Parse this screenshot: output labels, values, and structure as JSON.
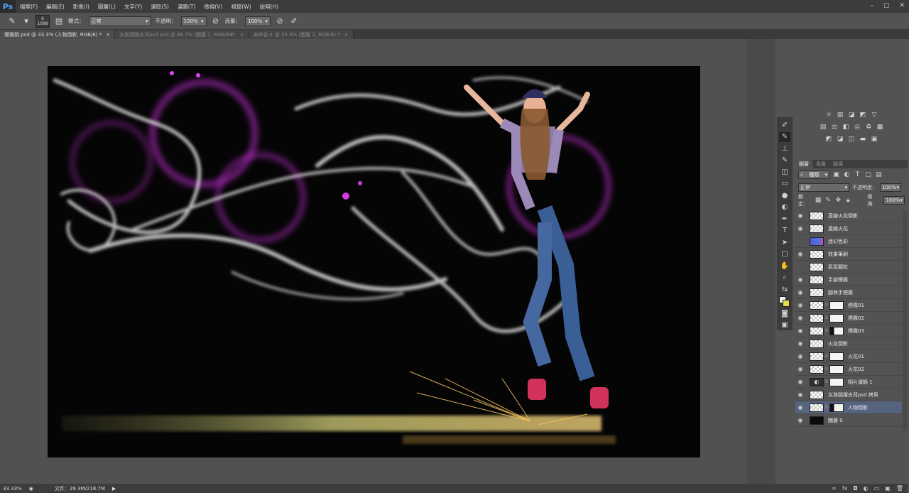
{
  "app": {
    "logo": "Ps"
  },
  "menu": [
    "檔案(F)",
    "編輯(E)",
    "影像(I)",
    "圖層(L)",
    "文字(Y)",
    "選取(S)",
    "濾鏡(T)",
    "檢視(V)",
    "視窗(W)",
    "說明(H)"
  ],
  "window_controls": [
    "–",
    "▢",
    "✕"
  ],
  "options": {
    "brush_size": "6",
    "brush_size2": "1098",
    "mode_label": "模式：",
    "mode_value": "正常",
    "opacity_label": "不透明：",
    "opacity_value": "100%",
    "flow_label": "流量：",
    "flow_value": "100%"
  },
  "tabs": [
    {
      "label": "煙霧跳.psd @ 33.3% (人物倒影, RGB/8) *"
    },
    {
      "label": "女孩跳躍去背psd.psd @ 66.7% (圖層 1, RGB/8#)"
    },
    {
      "label": "未命名-1 @ 33.3% (圖層 2, RGB/8) *"
    }
  ],
  "tab_close": "×",
  "layers_panel": {
    "tabs": [
      "圖層",
      "色版",
      "路徑"
    ],
    "filter_label": "種類",
    "blend_mode": "正常",
    "opacity_label": "不透明度：",
    "opacity_value": "100%",
    "lock_label": "鎖定：",
    "fill_label": "填滿：",
    "fill_value": "100%",
    "layers": [
      {
        "name": "直線火花倒影",
        "visible": true
      },
      {
        "name": "直線火花",
        "visible": true
      },
      {
        "name": "迷幻色彩",
        "visible": false
      },
      {
        "name": "效果筆刷",
        "visible": true
      },
      {
        "name": "氣氛顆粒",
        "visible": false
      },
      {
        "name": "手部煙霧",
        "visible": true
      },
      {
        "name": "腳與手煙霧",
        "visible": true
      },
      {
        "name": "煙霧01",
        "visible": true
      },
      {
        "name": "煙霧02",
        "visible": true
      },
      {
        "name": "煙霧03",
        "visible": true
      },
      {
        "name": "火花倒影",
        "visible": true
      },
      {
        "name": "火花01",
        "visible": true
      },
      {
        "name": "火花02",
        "visible": true
      },
      {
        "name": "相片濾鏡 1",
        "visible": true
      },
      {
        "name": "女孩跳躍去背psd 拷貝",
        "visible": true
      },
      {
        "name": "人物倒影",
        "visible": true
      },
      {
        "name": "圖層 0",
        "visible": true
      }
    ]
  },
  "status": {
    "zoom": "33.33%",
    "doc_info": "文件：29.3M/218.7M"
  },
  "colors": {
    "accent": "#4aa3ff",
    "selected_layer": "#566480",
    "foreground": "#f2f2f2",
    "background_swatch": "#e3e04a"
  }
}
